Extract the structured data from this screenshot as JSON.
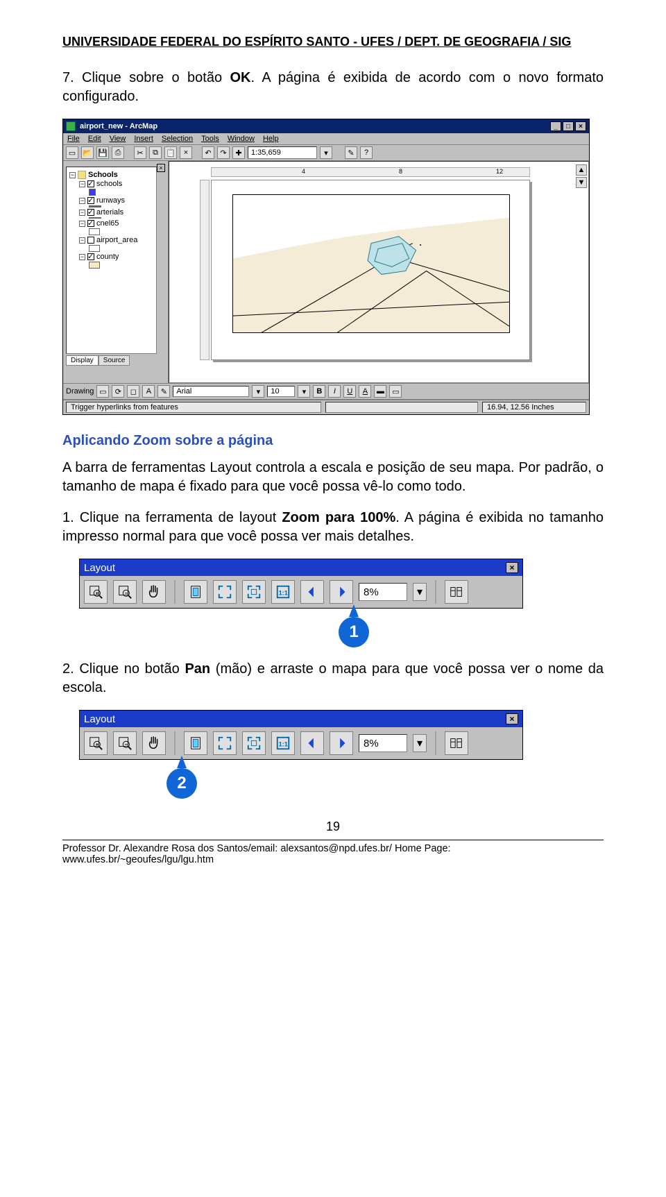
{
  "header": "UNIVERSIDADE FEDERAL DO ESPÍRITO SANTO - UFES / DEPT. DE GEOGRAFIA / SIG",
  "para1_prefix": "7. Clique sobre o botão ",
  "para1_bold": "OK",
  "para1_suffix": ". A página é exibida de acordo com o novo formato configurado.",
  "section_title": "Aplicando Zoom sobre a página",
  "para2": "A barra de ferramentas Layout controla a escala e posição de seu mapa. Por padrão, o tamanho de mapa é fixado para que você possa vê-lo como todo.",
  "para3_prefix": "1. Clique na ferramenta de layout ",
  "para3_bold": "Zoom para 100%",
  "para3_suffix": ". A página é exibida no tamanho impresso normal para que você possa ver mais detalhes.",
  "para4_prefix": "2. Clique no botão ",
  "para4_bold": "Pan",
  "para4_suffix": " (mão) e arraste o mapa para que você possa ver o nome da escola.",
  "callout1": "1",
  "callout2": "2",
  "page_number": "19",
  "footer": "Professor Dr. Alexandre Rosa dos Santos/email: alexsantos@npd.ufes.br/ Home Page: www.ufes.br/~geoufes/lgu/lgu.htm",
  "arcmap": {
    "title": "airport_new - ArcMap",
    "menus": [
      "File",
      "Edit",
      "View",
      "Insert",
      "Selection",
      "Tools",
      "Window",
      "Help"
    ],
    "scale": "1:35,659",
    "status_left": "Trigger hyperlinks from features",
    "status_right": "16.94, 12.56 Inches",
    "drawing_label": "Drawing",
    "font": "Arial",
    "font_size": "10",
    "ruler_marks": [
      "4",
      "8",
      "12"
    ],
    "toc_tabs": {
      "display": "Display",
      "source": "Source"
    },
    "toc": {
      "group": "Schools",
      "layers": [
        {
          "name": "schools",
          "checked": true,
          "swatch": "#3a3aef"
        },
        {
          "name": "runways",
          "checked": true,
          "swatch": "#888888"
        },
        {
          "name": "arterials",
          "checked": true,
          "swatch": "#888888"
        },
        {
          "name": "cnel65",
          "checked": true,
          "swatch": null,
          "sub_swatch": "#ffffff"
        },
        {
          "name": "airport_area",
          "checked": false,
          "swatch": null,
          "sub_swatch": "#ffffff"
        },
        {
          "name": "county",
          "checked": true,
          "swatch": null,
          "sub_swatch": "#f7eac3"
        }
      ]
    }
  },
  "layout_toolbar": {
    "title": "Layout",
    "percent": "8%"
  }
}
